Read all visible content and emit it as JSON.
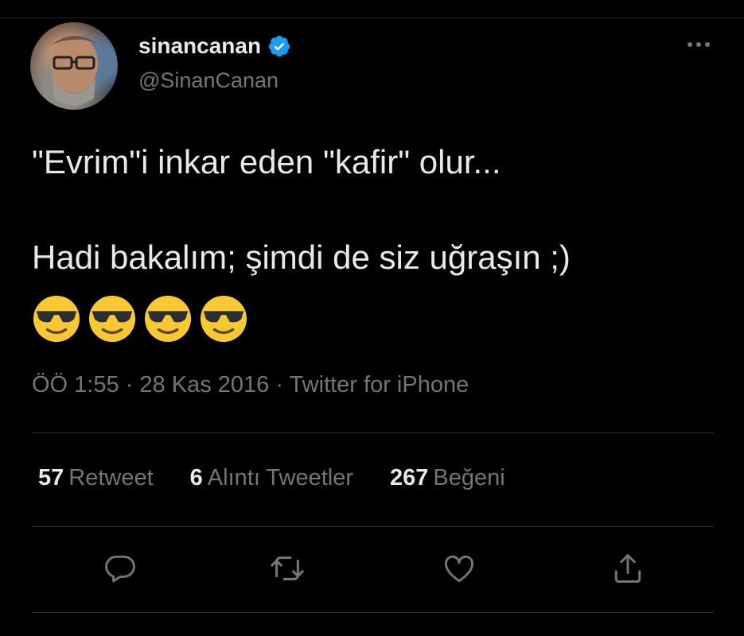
{
  "author": {
    "display_name": "sinancanan",
    "handle": "@SinanCanan",
    "verified": true
  },
  "tweet": {
    "text": "\"Evrim\"i inkar eden \"kafir\" olur...\n\nHadi bakalım; şimdi de siz uğraşın ;)",
    "emoji": [
      "😎",
      "😎",
      "😎",
      "😎"
    ]
  },
  "meta": {
    "time": "ÖÖ 1:55",
    "date": "28 Kas 2016",
    "separator": "·",
    "source": "Twitter for iPhone"
  },
  "stats": {
    "retweets_count": "57",
    "retweets_label": "Retweet",
    "quotes_count": "6",
    "quotes_label": "Alıntı Tweetler",
    "likes_count": "267",
    "likes_label": "Beğeni"
  },
  "colors": {
    "background": "#000000",
    "text_primary": "#e7e9ea",
    "text_secondary": "#71767b",
    "verified_blue": "#1d9bf0",
    "divider": "#2f3336"
  },
  "icons": {
    "verified": "verified-badge-icon",
    "more": "more-options-icon",
    "reply": "reply-icon",
    "retweet": "retweet-icon",
    "like": "like-icon",
    "share": "share-icon"
  }
}
